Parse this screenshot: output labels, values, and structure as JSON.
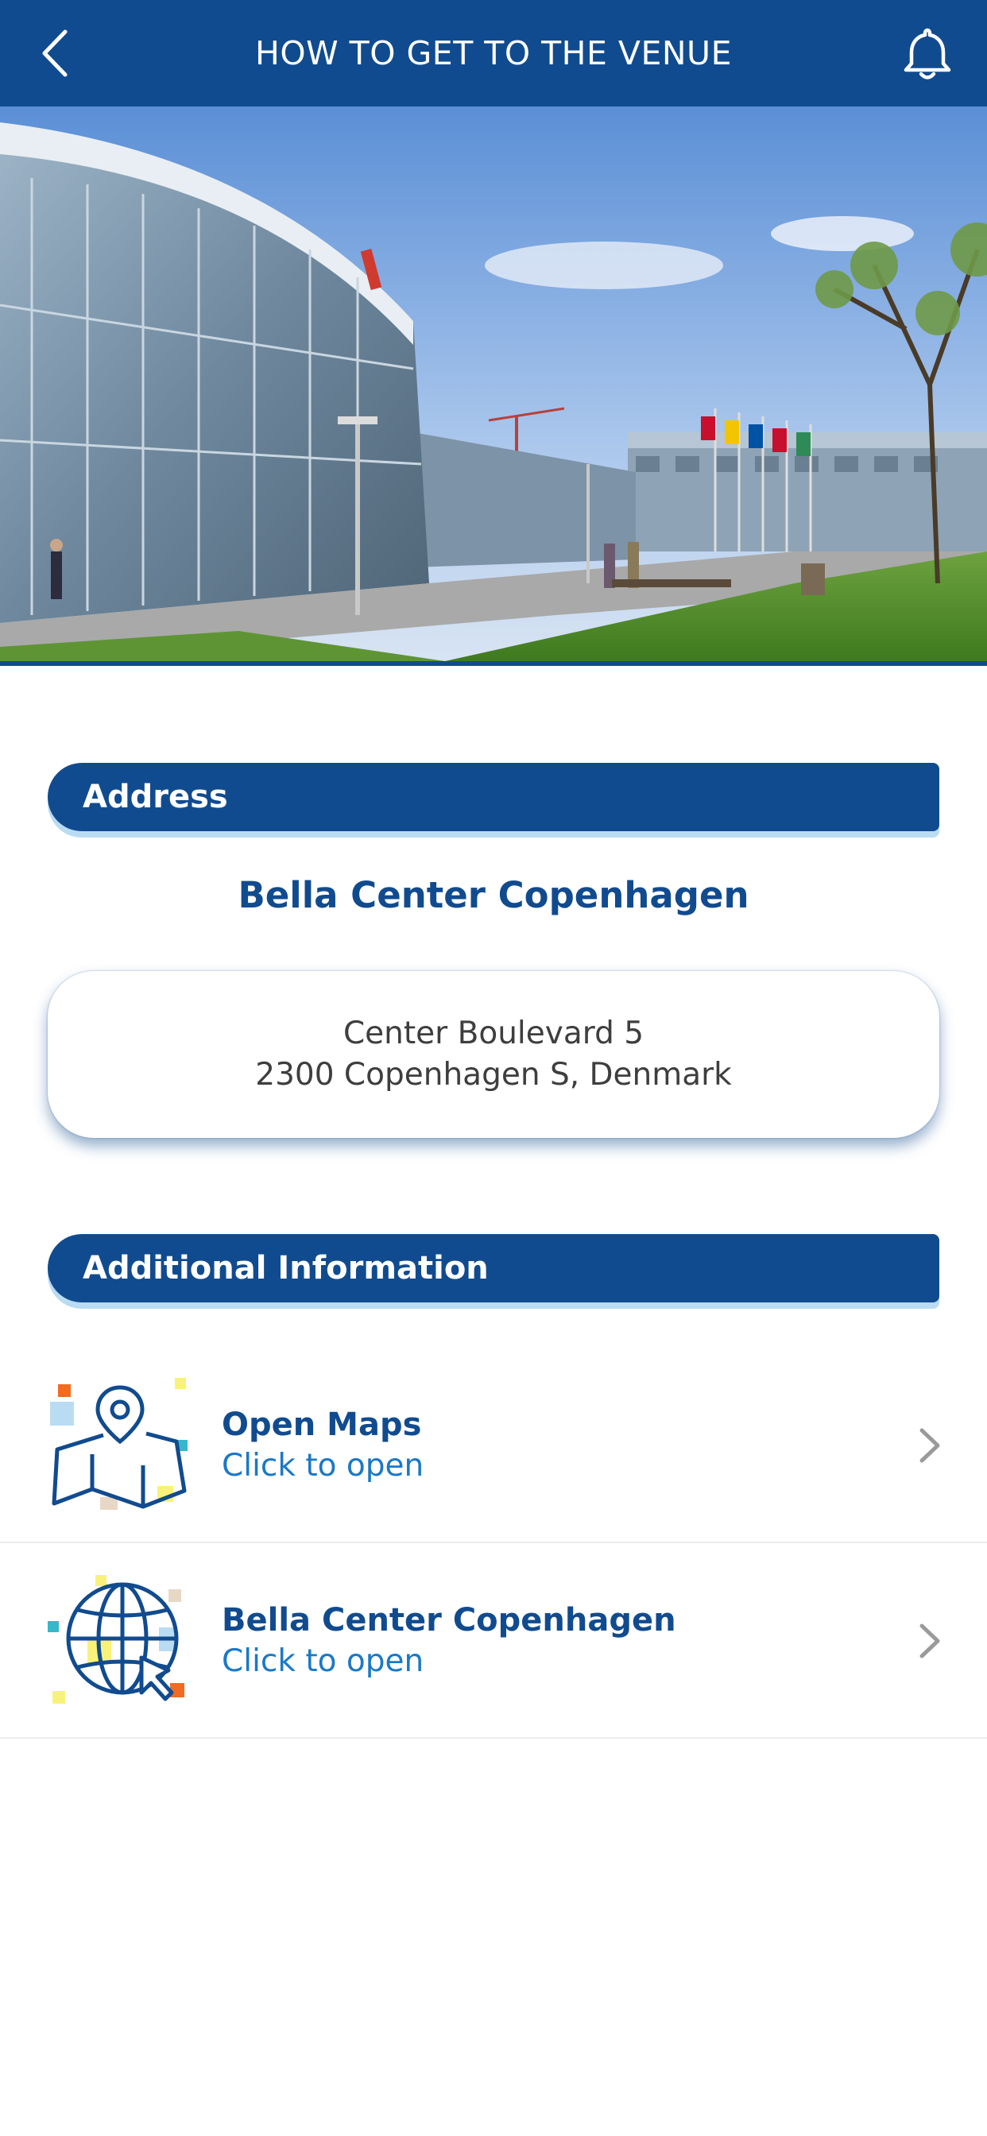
{
  "header": {
    "title": "HOW TO GET TO THE VENUE",
    "back_icon": "chevron-left-icon",
    "bell_icon": "bell-icon"
  },
  "colors": {
    "brand": "#114b8f",
    "link": "#1a79c7",
    "accent_shadow": "#b9dcf3"
  },
  "sections": {
    "address_label": "Address",
    "additional_label": "Additional Information"
  },
  "venue": {
    "name": "Bella Center Copenhagen",
    "address_line1": "Center Boulevard 5",
    "address_line2": "2300 Copenhagen S, Denmark"
  },
  "links": [
    {
      "title": "Open Maps",
      "subtitle": "Click to open",
      "icon": "map-pin-icon"
    },
    {
      "title": "Bella Center Copenhagen",
      "subtitle": "Click to open",
      "icon": "globe-cursor-icon"
    }
  ]
}
